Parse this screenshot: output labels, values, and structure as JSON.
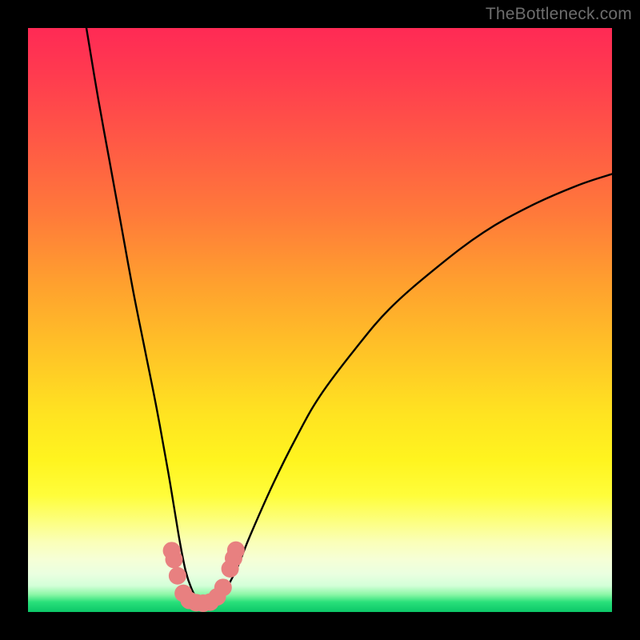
{
  "watermark": "TheBottleneck.com",
  "chart_data": {
    "type": "line",
    "title": "",
    "xlabel": "",
    "ylabel": "",
    "xlim": [
      0,
      100
    ],
    "ylim": [
      0,
      100
    ],
    "series": [
      {
        "name": "curve",
        "x": [
          10,
          12,
          14,
          16,
          18,
          20,
          22,
          24,
          25,
          26,
          27,
          28,
          29,
          30,
          31,
          32,
          33,
          34,
          36,
          38,
          42,
          46,
          50,
          56,
          62,
          70,
          78,
          86,
          94,
          100
        ],
        "y": [
          100,
          88,
          77,
          66,
          55,
          45,
          35,
          24,
          18,
          12,
          7,
          4,
          2.2,
          1.6,
          1.4,
          1.6,
          2.4,
          4,
          8,
          13,
          22,
          30,
          37,
          45,
          52,
          59,
          65,
          69.5,
          73,
          75
        ]
      }
    ],
    "markers": [
      {
        "x": 24.6,
        "y": 10.5,
        "r": 1.6
      },
      {
        "x": 25.0,
        "y": 9.0,
        "r": 1.6
      },
      {
        "x": 25.6,
        "y": 6.2,
        "r": 1.6
      },
      {
        "x": 26.6,
        "y": 3.2,
        "r": 1.6
      },
      {
        "x": 27.6,
        "y": 2.0,
        "r": 1.6
      },
      {
        "x": 28.8,
        "y": 1.6,
        "r": 1.6
      },
      {
        "x": 30.0,
        "y": 1.5,
        "r": 1.6
      },
      {
        "x": 31.2,
        "y": 1.7,
        "r": 1.6
      },
      {
        "x": 32.4,
        "y": 2.6,
        "r": 1.6
      },
      {
        "x": 33.4,
        "y": 4.2,
        "r": 1.6
      },
      {
        "x": 34.6,
        "y": 7.4,
        "r": 1.6
      },
      {
        "x": 35.2,
        "y": 9.2,
        "r": 1.6
      },
      {
        "x": 35.6,
        "y": 10.6,
        "r": 1.6
      }
    ],
    "marker_color": "#e88080"
  }
}
